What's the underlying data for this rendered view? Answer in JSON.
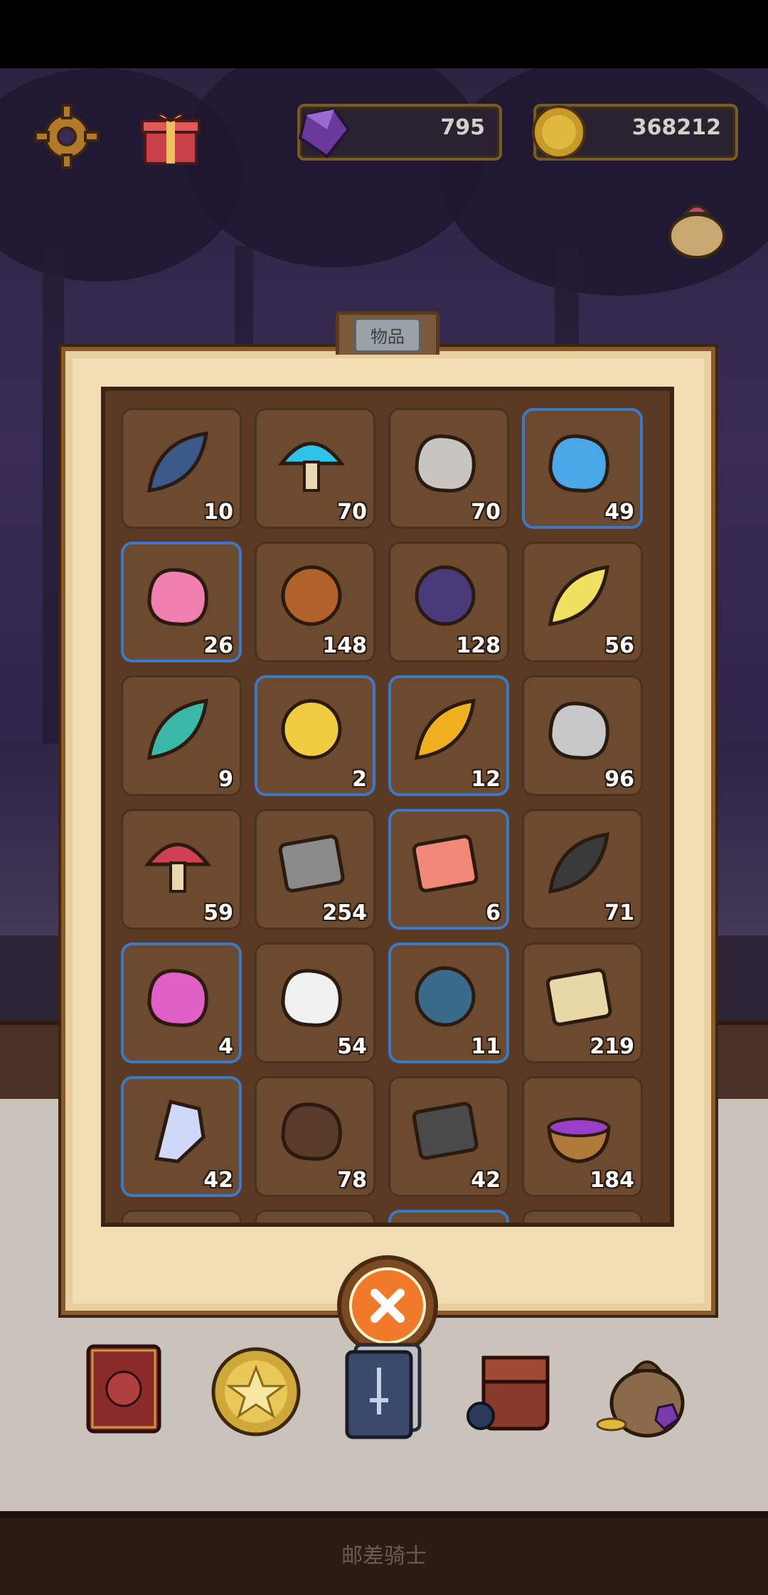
{
  "currencies": {
    "gems": "795",
    "coins": "368212"
  },
  "panel": {
    "tab_label": "物品",
    "items": [
      {
        "icon": "leaf-spiral-icon",
        "qty": "10",
        "rare": false,
        "color": "#3a5a8a"
      },
      {
        "icon": "blue-mushroom-icon",
        "qty": "70",
        "rare": false,
        "color": "#2ec4e8"
      },
      {
        "icon": "shell-horn-icon",
        "qty": "70",
        "rare": false,
        "color": "#c8c4c0"
      },
      {
        "icon": "blue-flower-icon",
        "qty": "49",
        "rare": true,
        "color": "#4aa8e8"
      },
      {
        "icon": "pink-clam-icon",
        "qty": "26",
        "rare": true,
        "color": "#f080b0"
      },
      {
        "icon": "acorn-icon",
        "qty": "148",
        "rare": false,
        "color": "#b0622a"
      },
      {
        "icon": "grapes-icon",
        "qty": "128",
        "rare": false,
        "color": "#4a3a7a"
      },
      {
        "icon": "glowing-lotus-icon",
        "qty": "56",
        "rare": false,
        "color": "#f0e060"
      },
      {
        "icon": "spiral-plant-icon",
        "qty": "9",
        "rare": false,
        "color": "#3ab8a8"
      },
      {
        "icon": "yellow-puffball-icon",
        "qty": "2",
        "rare": true,
        "color": "#f2cc40"
      },
      {
        "icon": "golden-leaf-icon",
        "qty": "12",
        "rare": true,
        "color": "#f0b020"
      },
      {
        "icon": "animal-hide-icon",
        "qty": "96",
        "rare": false,
        "color": "#c8c8c8"
      },
      {
        "icon": "red-mushroom-icon",
        "qty": "59",
        "rare": false,
        "color": "#d04050"
      },
      {
        "icon": "stone-slabs-icon",
        "qty": "254",
        "rare": false,
        "color": "#8a8a8a"
      },
      {
        "icon": "plaid-cloth-icon",
        "qty": "6",
        "rare": true,
        "color": "#f08878"
      },
      {
        "icon": "feather-icon",
        "qty": "71",
        "rare": false,
        "color": "#3a3a3a"
      },
      {
        "icon": "pink-crystal-icon",
        "qty": "4",
        "rare": true,
        "color": "#e060c8"
      },
      {
        "icon": "white-fur-icon",
        "qty": "54",
        "rare": false,
        "color": "#f0f0f0"
      },
      {
        "icon": "spiked-shell-icon",
        "qty": "11",
        "rare": true,
        "color": "#3a6a8a"
      },
      {
        "icon": "parchment-scroll-icon",
        "qty": "219",
        "rare": false,
        "color": "#e8d8a8"
      },
      {
        "icon": "ice-crystal-icon",
        "qty": "42",
        "rare": true,
        "color": "#d0d8f8"
      },
      {
        "icon": "lava-rock-icon",
        "qty": "78",
        "rare": false,
        "color": "#5a3a2a"
      },
      {
        "icon": "dark-cloth-icon",
        "qty": "42",
        "rare": false,
        "color": "#4a4a4a"
      },
      {
        "icon": "purple-potion-bowl-icon",
        "qty": "184",
        "rare": false,
        "color": "#9a40c8"
      }
    ]
  },
  "dock": [
    {
      "icon": "red-book-icon"
    },
    {
      "icon": "gold-star-coin-icon"
    },
    {
      "icon": "card-deck-icon"
    },
    {
      "icon": "backpack-icon"
    },
    {
      "icon": "treasure-sack-icon"
    }
  ],
  "footer": {
    "title": "邮差骑士"
  },
  "colors": {
    "rare_border": "#3a78c8",
    "panel_bg": "#f1ddb3",
    "slot_bg": "#6b4a30"
  }
}
